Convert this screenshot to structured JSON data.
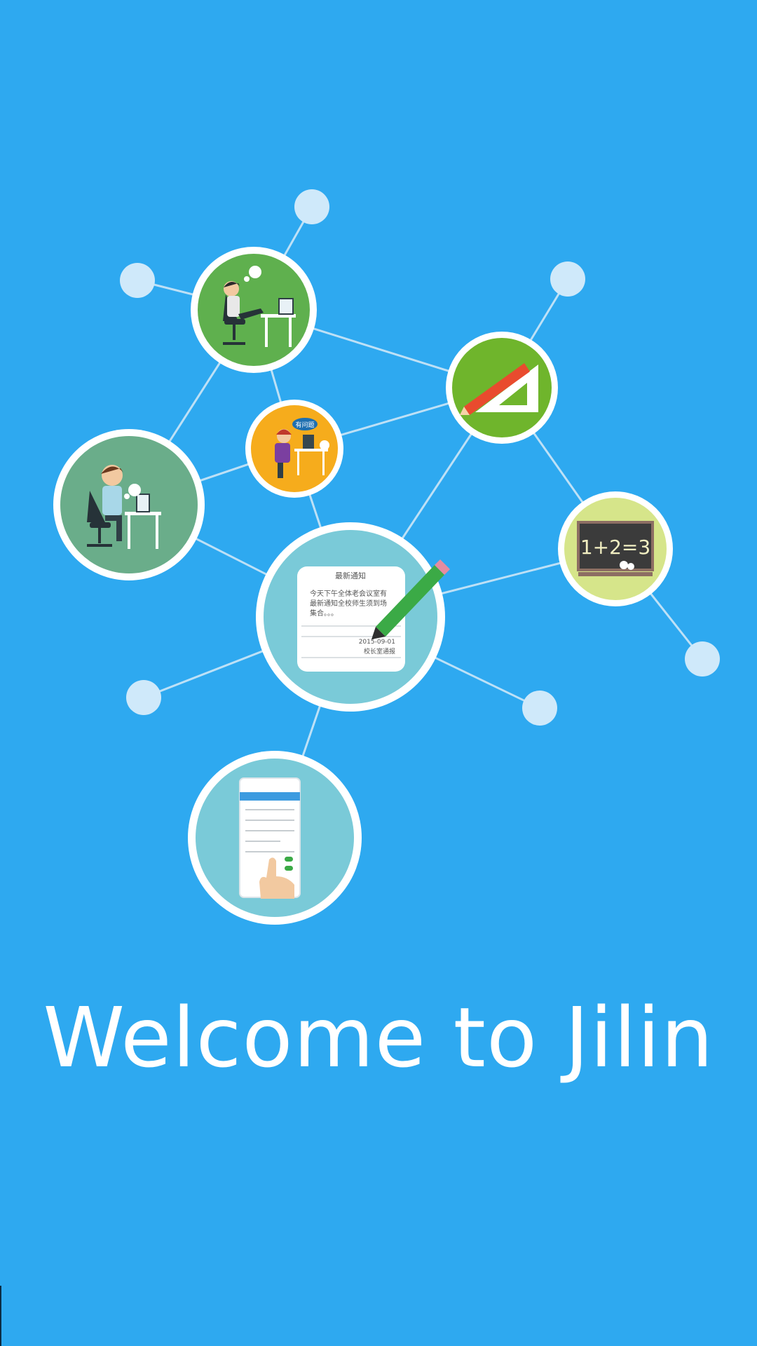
{
  "splash": {
    "welcome_text": "Welcome to Jilin",
    "background_color": "#2EA9F0"
  },
  "illustration": {
    "notice_card": {
      "heading": "最新通知",
      "line_1": "今天下午全体老会议室有",
      "line_2": "最新通知全校师生须到场",
      "line_3": "集合。。。",
      "date": "2015-09-01",
      "sender": "校长室通报"
    },
    "blackboard_text": "1+2=3",
    "bubble_text": "有问题"
  }
}
